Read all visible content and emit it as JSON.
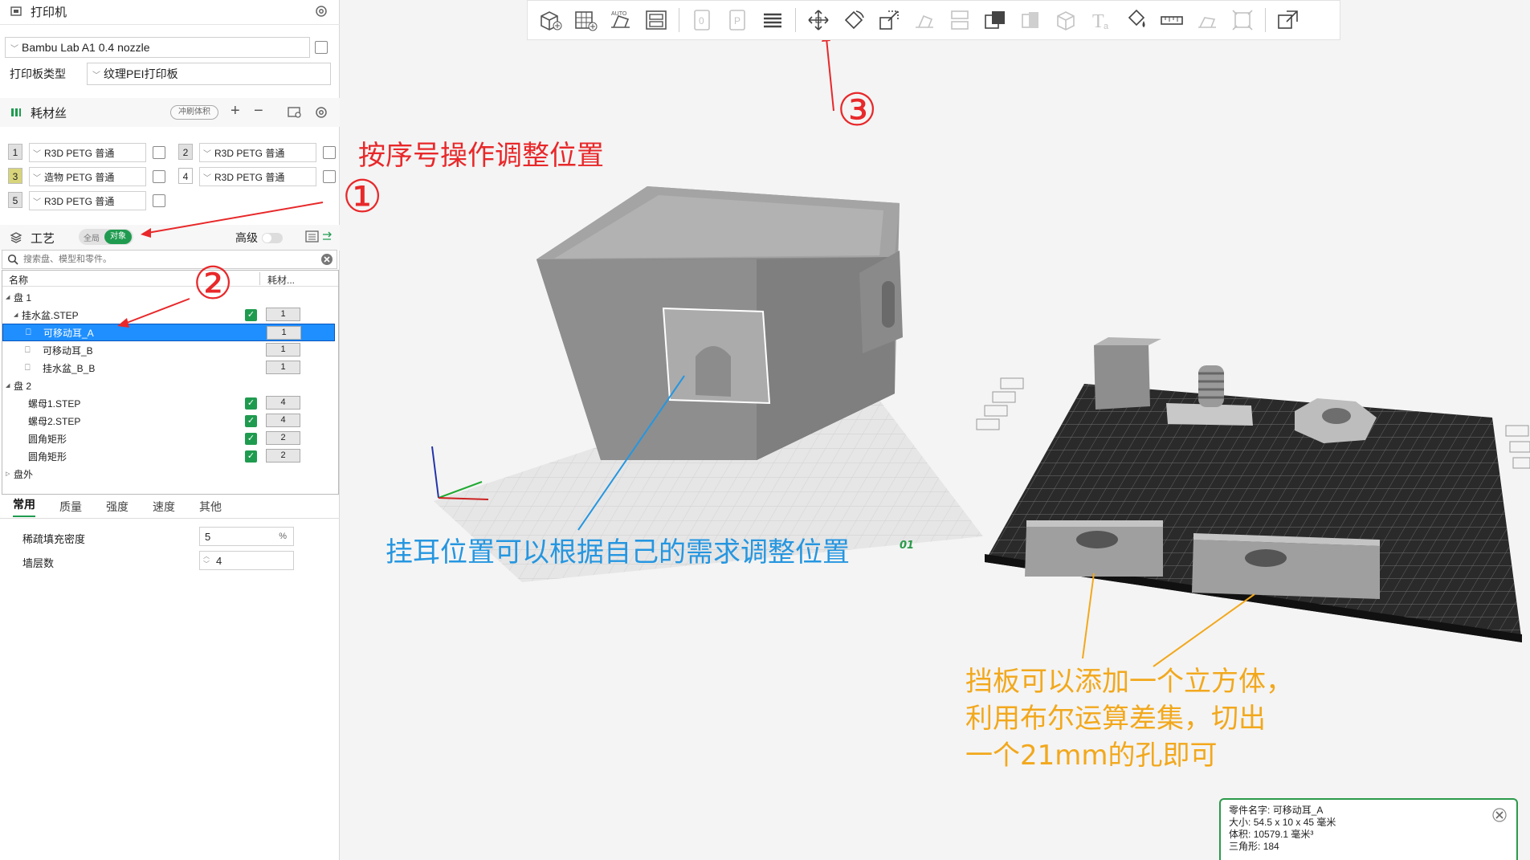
{
  "printer": {
    "section_title": "打印机",
    "model": "Bambu Lab A1 0.4 nozzle",
    "plate_type_label": "打印板类型",
    "plate_type": "纹理PEI打印板"
  },
  "filament": {
    "section_title": "耗材丝",
    "flush_label": "冲刷体积",
    "slots": [
      {
        "num": "1",
        "name": "R3D PETG 普通",
        "color": "#e0e0e0"
      },
      {
        "num": "2",
        "name": "R3D PETG 普通",
        "color": "#e0e0e0"
      },
      {
        "num": "3",
        "name": "造物 PETG 普通",
        "color": "#d8d47a"
      },
      {
        "num": "4",
        "name": "R3D PETG 普通",
        "color": "#ffffff"
      },
      {
        "num": "5",
        "name": "R3D PETG 普通",
        "color": "#e0e0e0"
      }
    ]
  },
  "process": {
    "section_title": "工艺",
    "toggle_global": "全局",
    "toggle_object": "对象",
    "advanced_label": "高级"
  },
  "search": {
    "placeholder": "搜索盘、模型和零件。"
  },
  "tree": {
    "col_name": "名称",
    "col_filament": "耗材...",
    "rows": [
      {
        "label": "盘 1",
        "filament": ""
      },
      {
        "label": "挂水盆.STEP",
        "filament": "1"
      },
      {
        "label": "可移动耳_A",
        "filament": "1"
      },
      {
        "label": "可移动耳_B",
        "filament": "1"
      },
      {
        "label": "挂水盆_B_B",
        "filament": "1"
      },
      {
        "label": "盘 2",
        "filament": ""
      },
      {
        "label": "螺母1.STEP",
        "filament": "4"
      },
      {
        "label": "螺母2.STEP",
        "filament": "4"
      },
      {
        "label": "圆角矩形",
        "filament": "2"
      },
      {
        "label": "圆角矩形",
        "filament": "2"
      },
      {
        "label": "盘外",
        "filament": ""
      }
    ]
  },
  "tabs": [
    "常用",
    "质量",
    "强度",
    "速度",
    "其他"
  ],
  "settings": {
    "infill_label": "稀疏填充密度",
    "infill_value": "5",
    "infill_unit": "%",
    "walls_label": "墙层数",
    "walls_value": "4"
  },
  "annotations": {
    "step_hint": "按序号操作调整位置",
    "circle1": "①",
    "circle2": "②",
    "circle3": "③",
    "ear_hint": "挂耳位置可以根据自己的需求调整位置",
    "baffle_line1": "挡板可以添加一个立方体，",
    "baffle_line2": "利用布尔运算差集，切出",
    "baffle_line3": "一个21mm的孔即可",
    "plate_label": "01"
  },
  "info": {
    "name_label": "零件名字:",
    "name_value": "可移动耳_A",
    "size_label": "大小:",
    "size_value": "54.5 x 10 x 45 毫米",
    "volume_label": "体积:",
    "volume_value": "10579.1 毫米³",
    "tri_label": "三角形:",
    "tri_value": "184"
  },
  "colors": {
    "accent": "#1f9b4f",
    "select": "#1f8fff",
    "annot_red": "#e8282a",
    "annot_blue": "#2596e0",
    "annot_orange": "#f2a81c"
  }
}
